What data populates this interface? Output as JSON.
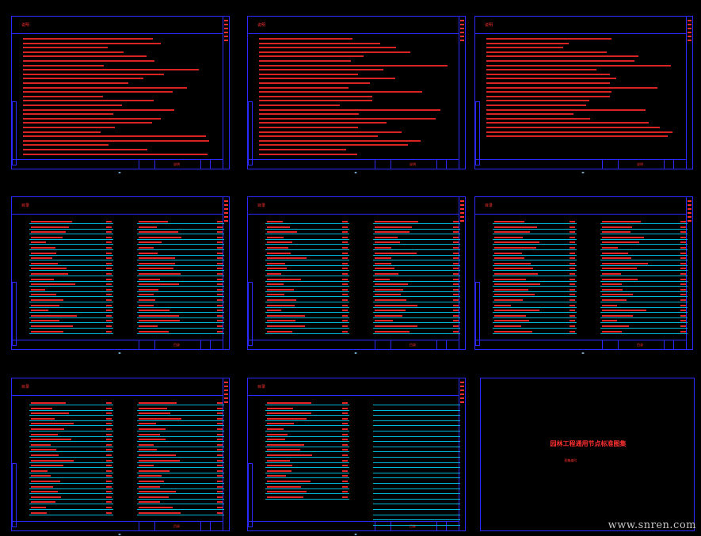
{
  "window_title": "",
  "sheets": [
    {
      "kind": "text",
      "title": "说明",
      "footer": "说明"
    },
    {
      "kind": "text",
      "title": "说明",
      "footer": "说明"
    },
    {
      "kind": "text",
      "title": "说明",
      "footer": "说明"
    },
    {
      "kind": "list",
      "title": "目录",
      "footer": "目录"
    },
    {
      "kind": "list",
      "title": "目录",
      "footer": "目录"
    },
    {
      "kind": "list",
      "title": "目录",
      "footer": "目录"
    },
    {
      "kind": "list",
      "title": "目录",
      "footer": "目录"
    },
    {
      "kind": "list",
      "title": "目录",
      "footer": "目录"
    },
    {
      "kind": "cover",
      "title": "园林工程通用节点标准图集",
      "subtitle": "图集编号"
    }
  ],
  "colors": {
    "frame": "#2a2aff",
    "text": "#ff3030",
    "rule": "#00b8d8",
    "background": "#000000"
  },
  "watermark": "www.snren.com"
}
